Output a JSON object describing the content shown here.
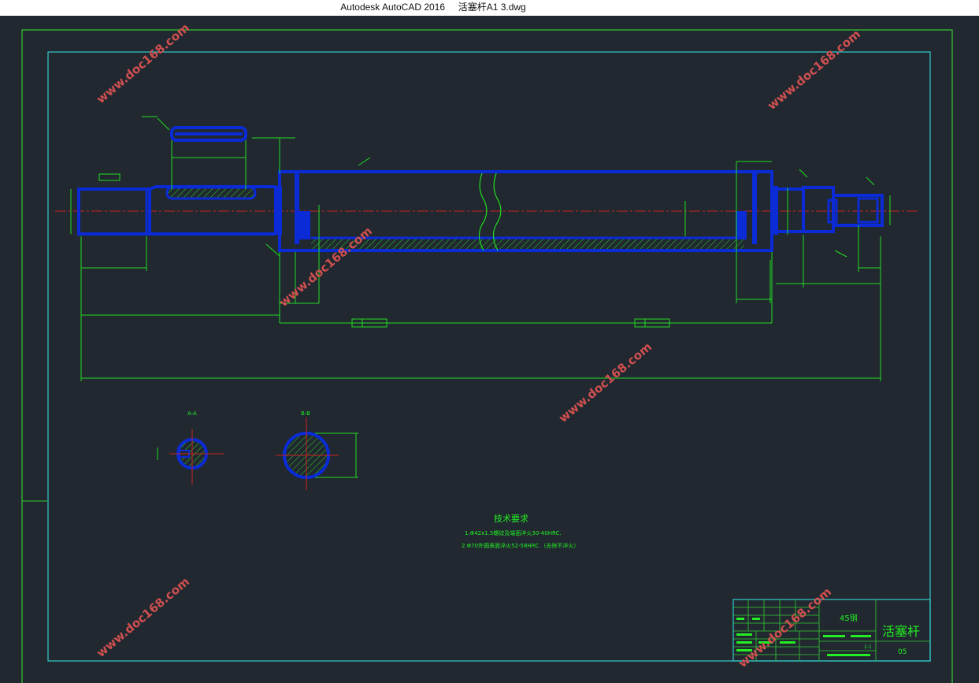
{
  "window": {
    "title": "Autodesk AutoCAD 2016     活塞杆A1 3.dwg"
  },
  "drawing": {
    "colors": {
      "background": "#212830",
      "frame_outer": "#33cc33",
      "frame_inner": "#33cccc",
      "part_outline": "#0a2bd6",
      "dimension": "#22dd22",
      "centerline": "#cc2222",
      "watermark": "#d05050",
      "text": "#22ee22"
    },
    "section_labels": {
      "a": "A-A",
      "b": "B-B"
    },
    "tech_requirements": {
      "heading": "技术要求",
      "line1": "1.Φ42x1.5螺纹及端面淬火30-40HRC.",
      "line2": "2.Φ70外圆表面淬火52-58HRC.（去除不淬火）"
    },
    "title_block": {
      "material": "45钢",
      "part_name": "活塞杆",
      "drawing_no": "05",
      "scale": "1:1"
    },
    "watermark_text": "www.doc168.com"
  }
}
